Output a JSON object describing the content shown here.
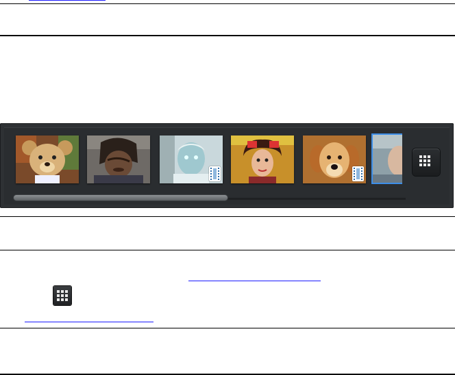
{
  "photo_strip": {
    "thumbnails": [
      {
        "name": "teddy-bear-photo",
        "video": false
      },
      {
        "name": "person-warped-photo",
        "video": false
      },
      {
        "name": "person-negative-photo",
        "video": true
      },
      {
        "name": "woman-cartoon-photo",
        "video": false
      },
      {
        "name": "golden-retriever-photo",
        "video": true
      },
      {
        "name": "person-partial-photo",
        "video": false
      }
    ],
    "selected_index": 5,
    "grid_icon": "grid-icon",
    "scroll_position": 0.0,
    "scroll_visible_fraction": 0.55
  },
  "colors": {
    "strip_bg": "#2e3134",
    "selection": "#3d8ee8",
    "link": "#1a1aff"
  }
}
